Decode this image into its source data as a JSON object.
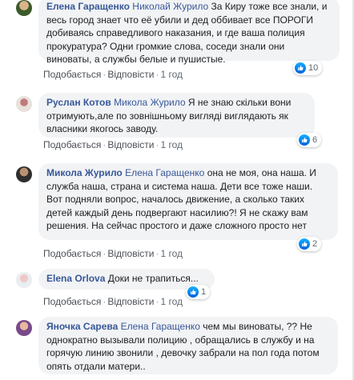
{
  "comments": [
    {
      "author": "Елена Гаращенко",
      "mention": "Николай Журило",
      "text": " За Киру тоже все знали, и весь город знает что её убили и дед оббивает все ПОРОГИ добиваясь справедливого наказания, и где ваша полиция прокуратура? Одни громкие слова, соседи знали они виноваты, а службы белые и пушистые.",
      "like": "Подобається",
      "reply": "Відповісти",
      "time": "1 год",
      "reactions": "10"
    },
    {
      "author": "Руслан Котов",
      "mention": "Микола Журило",
      "text": " Я не знаю скільки вони отримують,але по зовнішньому вигляді виглядають як власники якогось заводу.",
      "like": "Подобається",
      "reply": "Відповісти",
      "time": "1 год",
      "reactions": "6"
    },
    {
      "author": "Микола Журило",
      "mention": "Елена Гаращенко",
      "text": " она не моя, она наша. И служба наша, страна и система наша. Дети все тоже наши. Вот подняли вопрос, началось движение, а сколько таких детей каждый день подвергают насилию?! Я не скажу вам решения. На сейчас простого и даже сложного просто нет",
      "like": "Подобається",
      "reply": "Відповісти",
      "time": "1 год",
      "reactions": "2"
    },
    {
      "author": "Elena Orlova",
      "mention": "",
      "text": " Доки не трапиться...",
      "like": "Подобається",
      "reply": "Відповісти",
      "time": "1 год",
      "reactions": "1"
    },
    {
      "author": "Яночка Сарева",
      "mention": "Елена Гаращенко",
      "text": " чем мы виноваты, ?? Не однократно вызывали полицию , обращались в службу и на горячую линию звонили , девочку забрали на пол года потом опять отдали матери..",
      "like": "",
      "reply": "",
      "time": "",
      "reactions": ""
    }
  ],
  "colors": {
    "link": "#385898",
    "bubble": "#f2f3f5",
    "like_blue": "#1877f2"
  }
}
